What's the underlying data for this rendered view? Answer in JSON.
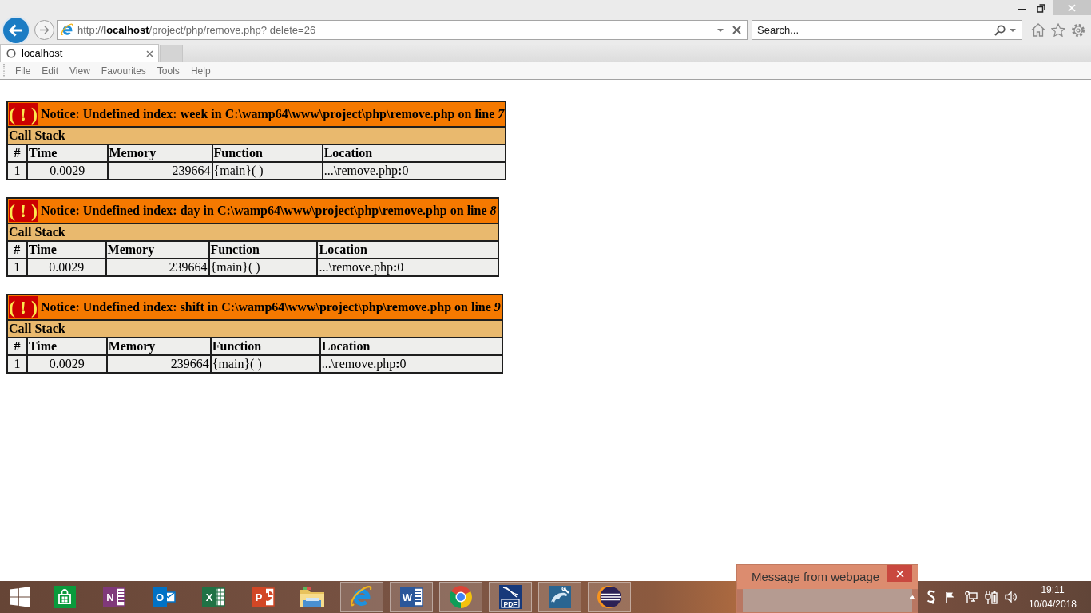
{
  "browser": {
    "address_bar": {
      "url": "http://**localhost**/project/php/remove.php? delete=26"
    },
    "search": {
      "placeholder": "Search..."
    },
    "tabs": [
      {
        "label": "localhost",
        "selected": true,
        "loading": true
      }
    ],
    "menu": [
      "File",
      "Edit",
      "View",
      "Favourites",
      "Tools",
      "Help"
    ]
  },
  "errors": [
    {
      "symbol": "( ! )",
      "message": "Notice: Undefined index: week in C:\\wamp64\\www\\project\\php\\remove.php on line *7*",
      "call_stack": "Call Stack",
      "columns": [
        "#",
        "Time",
        "Memory",
        "Function",
        "Location"
      ],
      "rows": [
        [
          "1",
          "0.0029",
          "239664",
          "{main}( )",
          "...\\remove.php**:**0"
        ]
      ]
    },
    {
      "symbol": "( ! )",
      "message": "Notice: Undefined index: day in C:\\wamp64\\www\\project\\php\\remove.php on line *8*",
      "call_stack": "Call Stack",
      "columns": [
        "#",
        "Time",
        "Memory",
        "Function",
        "Location"
      ],
      "rows": [
        [
          "1",
          "0.0029",
          "239664",
          "{main}( )",
          "...\\remove.php**:**0"
        ]
      ]
    },
    {
      "symbol": "( ! )",
      "message": "Notice: Undefined index: shift in C:\\wamp64\\www\\project\\php\\remove.php on line *9*",
      "call_stack": "Call Stack",
      "columns": [
        "#",
        "Time",
        "Memory",
        "Function",
        "Location"
      ],
      "rows": [
        [
          "1",
          "0.0029",
          "239664",
          "{main}( )",
          "...\\remove.php**:**0"
        ]
      ]
    }
  ],
  "dialog": {
    "title": "Message from webpage"
  },
  "taskbar": {
    "apps": [
      {
        "kind": "bag",
        "running": false
      },
      {
        "kind": "notebook",
        "letter": "N",
        "running": false
      },
      {
        "kind": "mail",
        "letter": "O",
        "running": false
      },
      {
        "kind": "spreadsheet",
        "letter": "X",
        "running": false
      },
      {
        "kind": "presentation",
        "letter": "P",
        "running": false
      },
      {
        "kind": "folder",
        "running": false
      },
      {
        "kind": "ebrowser",
        "running": true
      },
      {
        "kind": "document",
        "letter": "W",
        "running": true
      },
      {
        "kind": "ring",
        "running": true
      },
      {
        "kind": "pdf",
        "letter": "PDF",
        "running": true
      },
      {
        "kind": "dolphin",
        "running": true
      },
      {
        "kind": "sphere",
        "running": true
      }
    ],
    "clock": {
      "time": "19:11",
      "date": "10/04/2018"
    }
  }
}
